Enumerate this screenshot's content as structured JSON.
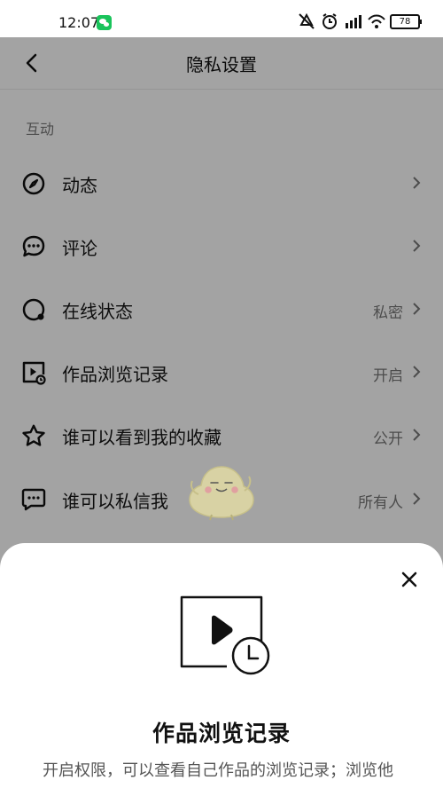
{
  "statusbar": {
    "time": "12:07",
    "battery": "78",
    "icons": [
      "wechat-icon",
      "mute-icon",
      "alarm-icon",
      "signal-icon",
      "wifi-icon",
      "battery-icon"
    ]
  },
  "header": {
    "title": "隐私设置"
  },
  "section": {
    "label": "互动"
  },
  "rows": [
    {
      "label": "动态",
      "value": "",
      "icon": "compass-icon"
    },
    {
      "label": "评论",
      "value": "",
      "icon": "comment-icon"
    },
    {
      "label": "在线状态",
      "value": "私密",
      "icon": "online-status-icon"
    },
    {
      "label": "作品浏览记录",
      "value": "开启",
      "icon": "video-history-icon"
    },
    {
      "label": "谁可以看到我的收藏",
      "value": "公开",
      "icon": "star-icon"
    },
    {
      "label": "谁可以私信我",
      "value": "所有人",
      "icon": "message-icon"
    }
  ],
  "sheet": {
    "title": "作品浏览记录",
    "description": "开启权限，可以查看自己作品的浏览记录；浏览他"
  },
  "colors": {
    "overlay": "#5f5f5f",
    "wechat": "#19c45b"
  }
}
